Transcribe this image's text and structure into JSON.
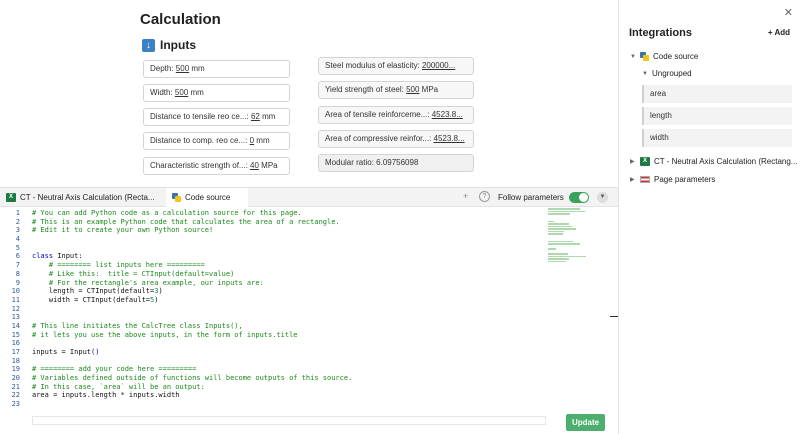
{
  "calculation": {
    "title": "Calculation",
    "inputs_heading": "Inputs",
    "inputs": [
      {
        "label": "Depth: ",
        "value": "500",
        "unit": " mm"
      },
      {
        "label": "Width: ",
        "value": "500",
        "unit": " mm"
      },
      {
        "label": "Distance to tensile reo ce...: ",
        "value": "62",
        "unit": " mm"
      },
      {
        "label": "Distance to comp. reo ce...: ",
        "value": "0",
        "unit": " mm"
      },
      {
        "label": "Characteristic strength of...: ",
        "value": "40",
        "unit": " MPa"
      }
    ],
    "outputs": [
      {
        "label": "Steel modulus of elasticity: ",
        "value": "200000..."
      },
      {
        "label": "Yield strength of steel: ",
        "value": "500",
        "unit": " MPa"
      },
      {
        "label": "Area of tensile reinforceme...: ",
        "value": "4523.8..."
      },
      {
        "label": "Area of compressive reinfor...: ",
        "value": "4523.8..."
      },
      {
        "label": "Modular ratio: ",
        "value": "6.09756098"
      }
    ]
  },
  "integrations": {
    "title": "Integrations",
    "add_label": "Add",
    "close_icon": "close-icon",
    "code_source_label": "Code source",
    "ungrouped_label": "Ungrouped",
    "ungrouped_items": [
      "area",
      "length",
      "width"
    ],
    "ct_label": "CT - Neutral Axis Calculation (Rectang...",
    "page_params_label": "Page parameters"
  },
  "editor": {
    "tabs": [
      {
        "label": "CT - Neutral Axis Calculation (Recta..."
      },
      {
        "label": "Code source"
      }
    ],
    "follow_label": "Follow parameters",
    "follow_on": true,
    "update_label": "Update",
    "lines": [
      [
        [
          "cm",
          "# You can add Python code as a calculation source for this page."
        ]
      ],
      [
        [
          "cm",
          "# This is an example Python code that calculates the area of a rectangle."
        ]
      ],
      [
        [
          "cm",
          "# Edit it to create your own Python source!"
        ]
      ],
      [],
      [],
      [
        [
          "kw",
          "class"
        ],
        [
          "pl",
          " Input:"
        ]
      ],
      [
        [
          "cm",
          "    # ======== list inputs here ========="
        ]
      ],
      [
        [
          "cm",
          "    # Like this:  title = CTInput(default=value)"
        ]
      ],
      [
        [
          "cm",
          "    # For the rectangle's area example, our inputs are:"
        ]
      ],
      [
        [
          "pl",
          "    length = CTInput(default="
        ],
        [
          "nm",
          "3"
        ],
        [
          "pl",
          ")"
        ]
      ],
      [
        [
          "pl",
          "    width = CTInput(default="
        ],
        [
          "nm",
          "5"
        ],
        [
          "pl",
          ")"
        ]
      ],
      [],
      [],
      [
        [
          "cm",
          "# This line initiates the CalcTree class Inputs(),"
        ]
      ],
      [
        [
          "cm",
          "# it lets you use the above inputs, in the form of inputs.title"
        ]
      ],
      [],
      [
        [
          "pl",
          "inputs = Input"
        ],
        [
          "kw",
          "()"
        ]
      ],
      [],
      [
        [
          "cm",
          "# ======== add your code here ========="
        ]
      ],
      [
        [
          "cm",
          "# Variables defined outside of functions will become outputs of this source."
        ]
      ],
      [
        [
          "cm",
          "# In this case, `area` will be an output:"
        ]
      ],
      [
        [
          "pl",
          "area = inputs.length * inputs.width"
        ]
      ],
      []
    ]
  }
}
